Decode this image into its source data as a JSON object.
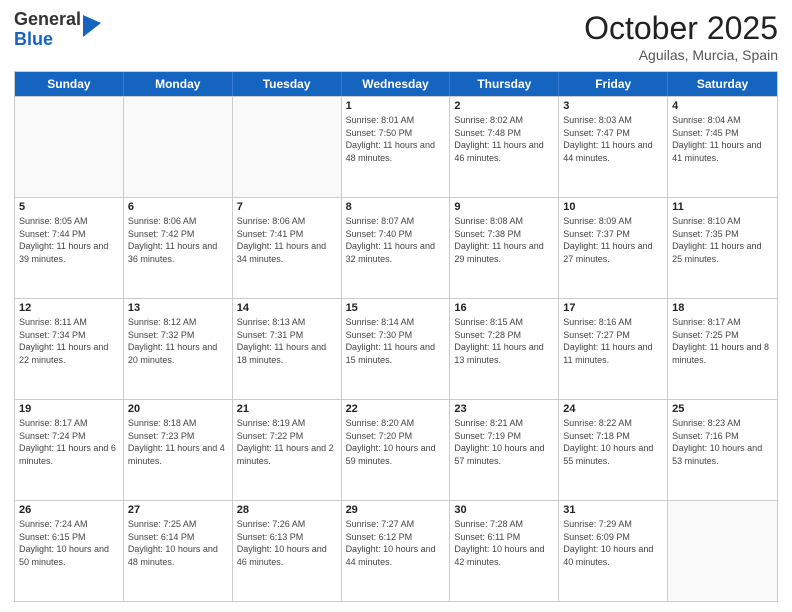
{
  "logo": {
    "general": "General",
    "blue": "Blue"
  },
  "title": {
    "month": "October 2025",
    "location": "Aguilas, Murcia, Spain"
  },
  "headers": [
    "Sunday",
    "Monday",
    "Tuesday",
    "Wednesday",
    "Thursday",
    "Friday",
    "Saturday"
  ],
  "weeks": [
    [
      {
        "day": "",
        "sunrise": "",
        "sunset": "",
        "daylight": ""
      },
      {
        "day": "",
        "sunrise": "",
        "sunset": "",
        "daylight": ""
      },
      {
        "day": "",
        "sunrise": "",
        "sunset": "",
        "daylight": ""
      },
      {
        "day": "1",
        "sunrise": "Sunrise: 8:01 AM",
        "sunset": "Sunset: 7:50 PM",
        "daylight": "Daylight: 11 hours and 48 minutes."
      },
      {
        "day": "2",
        "sunrise": "Sunrise: 8:02 AM",
        "sunset": "Sunset: 7:48 PM",
        "daylight": "Daylight: 11 hours and 46 minutes."
      },
      {
        "day": "3",
        "sunrise": "Sunrise: 8:03 AM",
        "sunset": "Sunset: 7:47 PM",
        "daylight": "Daylight: 11 hours and 44 minutes."
      },
      {
        "day": "4",
        "sunrise": "Sunrise: 8:04 AM",
        "sunset": "Sunset: 7:45 PM",
        "daylight": "Daylight: 11 hours and 41 minutes."
      }
    ],
    [
      {
        "day": "5",
        "sunrise": "Sunrise: 8:05 AM",
        "sunset": "Sunset: 7:44 PM",
        "daylight": "Daylight: 11 hours and 39 minutes."
      },
      {
        "day": "6",
        "sunrise": "Sunrise: 8:06 AM",
        "sunset": "Sunset: 7:42 PM",
        "daylight": "Daylight: 11 hours and 36 minutes."
      },
      {
        "day": "7",
        "sunrise": "Sunrise: 8:06 AM",
        "sunset": "Sunset: 7:41 PM",
        "daylight": "Daylight: 11 hours and 34 minutes."
      },
      {
        "day": "8",
        "sunrise": "Sunrise: 8:07 AM",
        "sunset": "Sunset: 7:40 PM",
        "daylight": "Daylight: 11 hours and 32 minutes."
      },
      {
        "day": "9",
        "sunrise": "Sunrise: 8:08 AM",
        "sunset": "Sunset: 7:38 PM",
        "daylight": "Daylight: 11 hours and 29 minutes."
      },
      {
        "day": "10",
        "sunrise": "Sunrise: 8:09 AM",
        "sunset": "Sunset: 7:37 PM",
        "daylight": "Daylight: 11 hours and 27 minutes."
      },
      {
        "day": "11",
        "sunrise": "Sunrise: 8:10 AM",
        "sunset": "Sunset: 7:35 PM",
        "daylight": "Daylight: 11 hours and 25 minutes."
      }
    ],
    [
      {
        "day": "12",
        "sunrise": "Sunrise: 8:11 AM",
        "sunset": "Sunset: 7:34 PM",
        "daylight": "Daylight: 11 hours and 22 minutes."
      },
      {
        "day": "13",
        "sunrise": "Sunrise: 8:12 AM",
        "sunset": "Sunset: 7:32 PM",
        "daylight": "Daylight: 11 hours and 20 minutes."
      },
      {
        "day": "14",
        "sunrise": "Sunrise: 8:13 AM",
        "sunset": "Sunset: 7:31 PM",
        "daylight": "Daylight: 11 hours and 18 minutes."
      },
      {
        "day": "15",
        "sunrise": "Sunrise: 8:14 AM",
        "sunset": "Sunset: 7:30 PM",
        "daylight": "Daylight: 11 hours and 15 minutes."
      },
      {
        "day": "16",
        "sunrise": "Sunrise: 8:15 AM",
        "sunset": "Sunset: 7:28 PM",
        "daylight": "Daylight: 11 hours and 13 minutes."
      },
      {
        "day": "17",
        "sunrise": "Sunrise: 8:16 AM",
        "sunset": "Sunset: 7:27 PM",
        "daylight": "Daylight: 11 hours and 11 minutes."
      },
      {
        "day": "18",
        "sunrise": "Sunrise: 8:17 AM",
        "sunset": "Sunset: 7:25 PM",
        "daylight": "Daylight: 11 hours and 8 minutes."
      }
    ],
    [
      {
        "day": "19",
        "sunrise": "Sunrise: 8:17 AM",
        "sunset": "Sunset: 7:24 PM",
        "daylight": "Daylight: 11 hours and 6 minutes."
      },
      {
        "day": "20",
        "sunrise": "Sunrise: 8:18 AM",
        "sunset": "Sunset: 7:23 PM",
        "daylight": "Daylight: 11 hours and 4 minutes."
      },
      {
        "day": "21",
        "sunrise": "Sunrise: 8:19 AM",
        "sunset": "Sunset: 7:22 PM",
        "daylight": "Daylight: 11 hours and 2 minutes."
      },
      {
        "day": "22",
        "sunrise": "Sunrise: 8:20 AM",
        "sunset": "Sunset: 7:20 PM",
        "daylight": "Daylight: 10 hours and 59 minutes."
      },
      {
        "day": "23",
        "sunrise": "Sunrise: 8:21 AM",
        "sunset": "Sunset: 7:19 PM",
        "daylight": "Daylight: 10 hours and 57 minutes."
      },
      {
        "day": "24",
        "sunrise": "Sunrise: 8:22 AM",
        "sunset": "Sunset: 7:18 PM",
        "daylight": "Daylight: 10 hours and 55 minutes."
      },
      {
        "day": "25",
        "sunrise": "Sunrise: 8:23 AM",
        "sunset": "Sunset: 7:16 PM",
        "daylight": "Daylight: 10 hours and 53 minutes."
      }
    ],
    [
      {
        "day": "26",
        "sunrise": "Sunrise: 7:24 AM",
        "sunset": "Sunset: 6:15 PM",
        "daylight": "Daylight: 10 hours and 50 minutes."
      },
      {
        "day": "27",
        "sunrise": "Sunrise: 7:25 AM",
        "sunset": "Sunset: 6:14 PM",
        "daylight": "Daylight: 10 hours and 48 minutes."
      },
      {
        "day": "28",
        "sunrise": "Sunrise: 7:26 AM",
        "sunset": "Sunset: 6:13 PM",
        "daylight": "Daylight: 10 hours and 46 minutes."
      },
      {
        "day": "29",
        "sunrise": "Sunrise: 7:27 AM",
        "sunset": "Sunset: 6:12 PM",
        "daylight": "Daylight: 10 hours and 44 minutes."
      },
      {
        "day": "30",
        "sunrise": "Sunrise: 7:28 AM",
        "sunset": "Sunset: 6:11 PM",
        "daylight": "Daylight: 10 hours and 42 minutes."
      },
      {
        "day": "31",
        "sunrise": "Sunrise: 7:29 AM",
        "sunset": "Sunset: 6:09 PM",
        "daylight": "Daylight: 10 hours and 40 minutes."
      },
      {
        "day": "",
        "sunrise": "",
        "sunset": "",
        "daylight": ""
      }
    ]
  ]
}
